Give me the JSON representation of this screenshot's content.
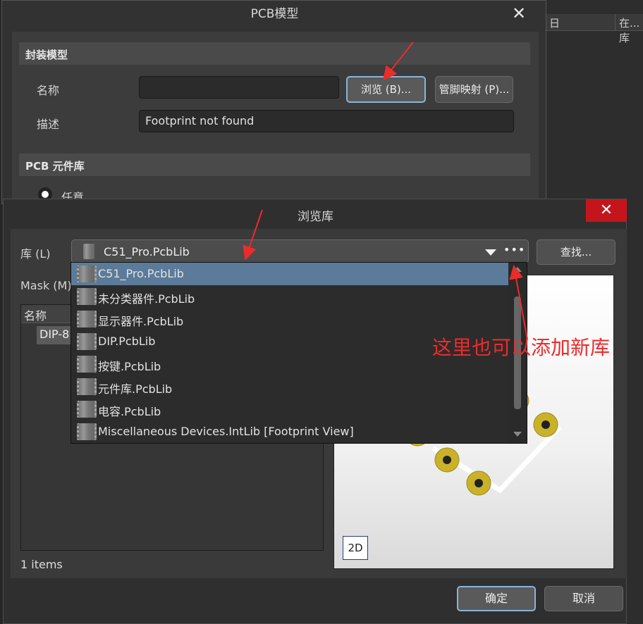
{
  "background": {
    "right_column_fragment_1": "在...库",
    "right_column_fragment_2": "日"
  },
  "pcb_dialog": {
    "title": "PCB模型",
    "close_glyph": "✕",
    "footprint_section": "封装模型",
    "name_label": "名称",
    "name_value": "",
    "browse_button": "浏览 (B)...",
    "pin_map_button": "管脚映射 (P)...",
    "description_label": "描述",
    "description_value": "Footprint not found",
    "library_section": "PCB 元件库",
    "any_option": "任意"
  },
  "browse_dialog": {
    "title": "浏览库",
    "close_glyph": "✕",
    "library_label": "库 (L)",
    "library_selected": "C51_Pro.PcbLib",
    "ellipsis": "•••",
    "find_button": "查找...",
    "mask_label": "Mask (M)",
    "list_header_name": "名称",
    "list_items": [
      "DIP-8"
    ],
    "item_count": "1 items",
    "view_2d": "2D",
    "ok_button": "确定",
    "cancel_button": "取消",
    "dropdown_items": [
      "C51_Pro.PcbLib",
      "未分类器件.PcbLib",
      "显示器件.PcbLib",
      "DIP.PcbLib",
      "按键.PcbLib",
      "元件库.PcbLib",
      "电容.PcbLib",
      "Miscellaneous Devices.IntLib [Footprint View]"
    ],
    "dropdown_selected_index": 0
  },
  "annotation": {
    "text": "这里也可以添加新库",
    "color": "#ec2b2b"
  },
  "colors": {
    "selection": "#5c7b9a",
    "close_red": "#c4151c",
    "pad_gold": "#c9b22a"
  }
}
